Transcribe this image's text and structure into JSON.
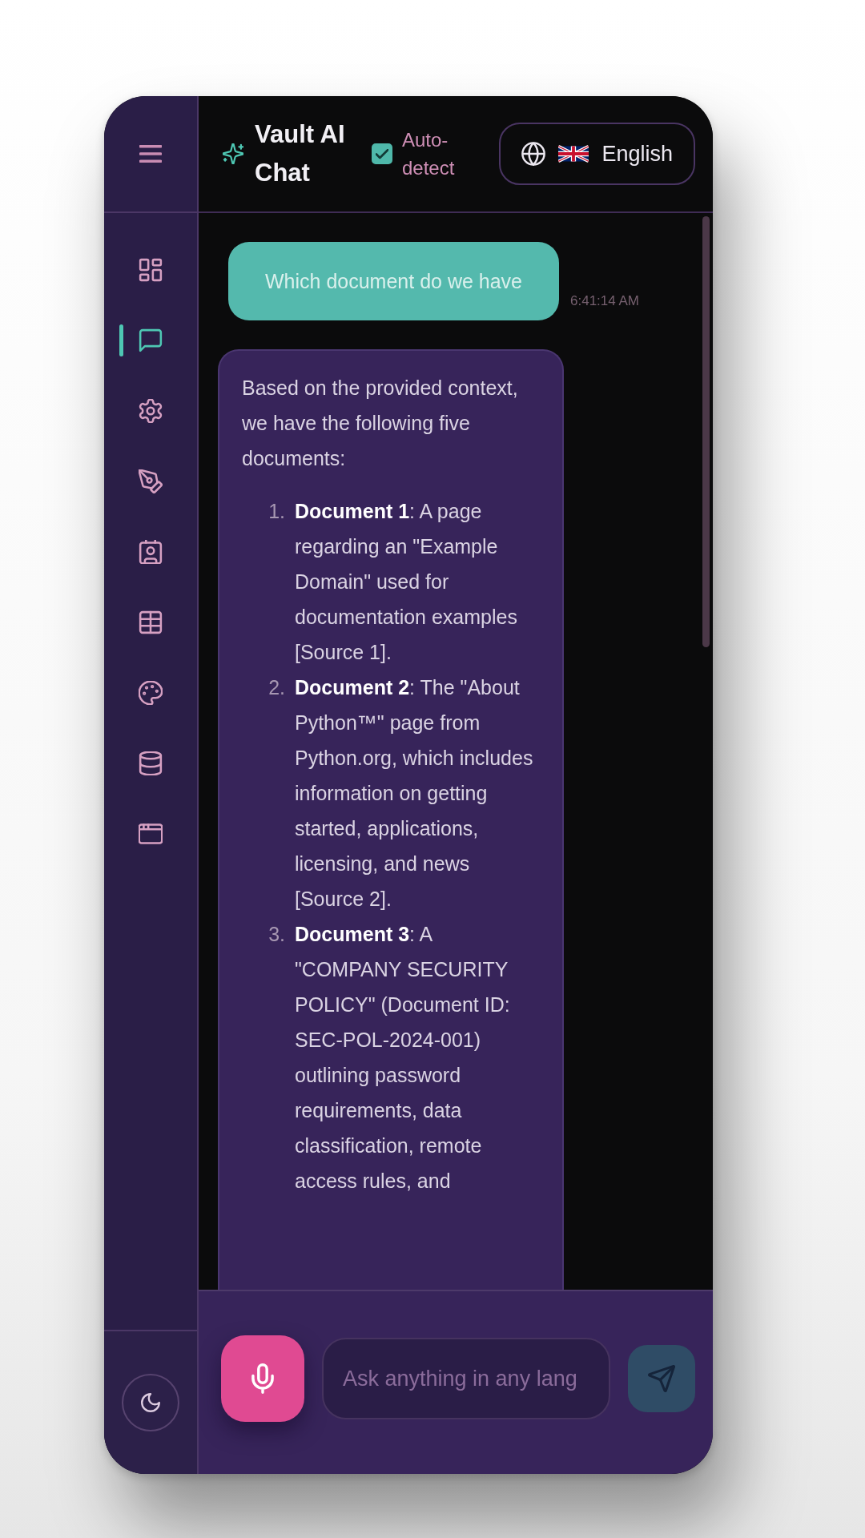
{
  "sidebar": {
    "items": [
      {
        "selected": false
      },
      {
        "selected": true
      },
      {
        "selected": false
      },
      {
        "selected": false
      },
      {
        "selected": false
      },
      {
        "selected": false
      },
      {
        "selected": false
      },
      {
        "selected": false
      },
      {
        "selected": false
      }
    ]
  },
  "header": {
    "title": "Vault AI Chat",
    "auto_detect": {
      "label": "Auto-detect",
      "checked": true
    },
    "language": {
      "label": "English"
    }
  },
  "messages": [
    {
      "kind": "user",
      "text": "Which document do we have",
      "time": "6:41:14 AM"
    },
    {
      "kind": "assistant",
      "intro": "Based on the provided context, we have the following five documents:",
      "items": [
        {
          "number": "1.",
          "text": "**Document 1**: A page regarding an \"Example Domain\" used for documentation examples [Source 1]."
        },
        {
          "number": "2.",
          "text": "**Document 2**: The \"About Python™\" page from Python.org, which includes information on getting started, applications, licensing, and news [Source 2]."
        },
        {
          "number": "3.",
          "text": "**Document 3**: A \"COMPANY SECURITY POLICY\" (Document ID: SEC-POL-2024-001) outlining password requirements, data classification, remote access rules, and"
        }
      ]
    }
  ],
  "composer": {
    "placeholder": "Ask anything in any lang"
  }
}
